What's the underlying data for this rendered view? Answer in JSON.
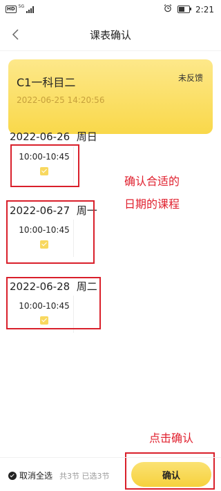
{
  "status_bar": {
    "hd": "HD",
    "network": "5G",
    "time": "2:21",
    "battery_level": 0.55
  },
  "header": {
    "title": "课表确认",
    "back_icon": "chevron-left-icon"
  },
  "course_card": {
    "name": "C1一科目二",
    "status": "未反馈",
    "datetime": "2022-06-25 14:20:56"
  },
  "days": [
    {
      "date": "2022-06-26",
      "weekday": "周日",
      "slot_time": "10:00-10:45",
      "checked": true
    },
    {
      "date": "2022-06-27",
      "weekday": "周一",
      "slot_time": "10:00-10:45",
      "checked": true
    },
    {
      "date": "2022-06-28",
      "weekday": "周二",
      "slot_time": "10:00-10:45",
      "checked": true
    }
  ],
  "annotations": {
    "line1": "确认合适的",
    "line2": "日期的课程",
    "confirm_hint": "点击确认"
  },
  "footer": {
    "cancel_all_label": "取消全选",
    "total_lessons": "共3节",
    "selected_lessons": "已选3节",
    "confirm_label": "确认"
  },
  "colors": {
    "accent_yellow": "#f9d84a",
    "annotation_red": "#e0202e",
    "card_time": "#c6a03c"
  }
}
